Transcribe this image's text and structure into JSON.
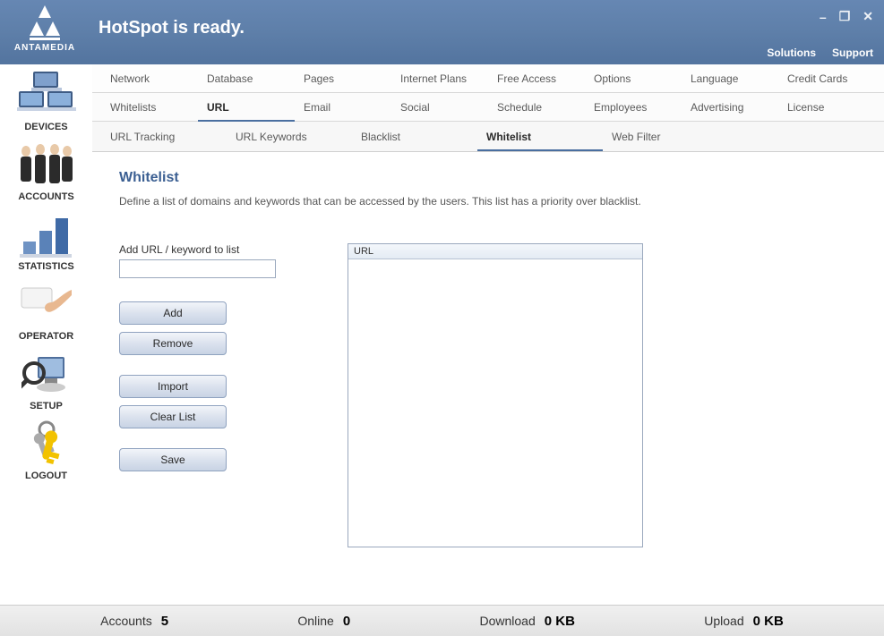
{
  "brand": {
    "name": "ANTAMEDIA"
  },
  "header": {
    "title": "HotSpot is ready.",
    "links": {
      "solutions": "Solutions",
      "support": "Support"
    }
  },
  "sidebar": {
    "items": [
      {
        "label": "DEVICES"
      },
      {
        "label": "ACCOUNTS"
      },
      {
        "label": "STATISTICS"
      },
      {
        "label": "OPERATOR"
      },
      {
        "label": "SETUP"
      },
      {
        "label": "LOGOUT"
      }
    ]
  },
  "tabs": {
    "primary": [
      {
        "label": "Network"
      },
      {
        "label": "Database"
      },
      {
        "label": "Pages"
      },
      {
        "label": "Internet Plans"
      },
      {
        "label": "Free Access"
      },
      {
        "label": "Options"
      },
      {
        "label": "Language"
      },
      {
        "label": "Credit Cards"
      }
    ],
    "secondary": [
      {
        "label": "Whitelists"
      },
      {
        "label": "URL"
      },
      {
        "label": "Email"
      },
      {
        "label": "Social"
      },
      {
        "label": "Schedule"
      },
      {
        "label": "Employees"
      },
      {
        "label": "Advertising"
      },
      {
        "label": "License"
      }
    ],
    "tertiary": [
      {
        "label": "URL Tracking"
      },
      {
        "label": "URL Keywords"
      },
      {
        "label": "Blacklist"
      },
      {
        "label": "Whitelist"
      },
      {
        "label": "Web Filter"
      }
    ]
  },
  "panel": {
    "title": "Whitelist",
    "description": "Define a list of domains and keywords that can be accessed by the users. This list has a priority over blacklist.",
    "add_label": "Add URL / keyword to list",
    "input_value": "",
    "buttons": {
      "add": "Add",
      "remove": "Remove",
      "import": "Import",
      "clear": "Clear List",
      "save": "Save"
    },
    "list": {
      "header": "URL",
      "items": []
    }
  },
  "statusbar": {
    "accounts_label": "Accounts",
    "accounts_value": "5",
    "online_label": "Online",
    "online_value": "0",
    "download_label": "Download",
    "download_value": "0 KB",
    "upload_label": "Upload",
    "upload_value": "0 KB"
  }
}
